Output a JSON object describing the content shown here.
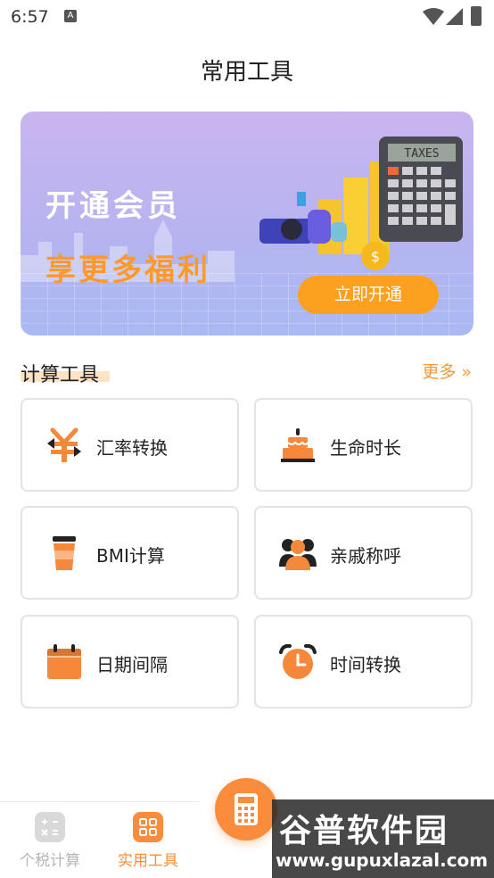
{
  "status_bar": {
    "time": "6:57",
    "notif_icon": "A"
  },
  "header": {
    "title": "常用工具"
  },
  "banner": {
    "line1": "开通会员",
    "line2": "享更多福利",
    "button_label": "立即开通",
    "calculator_label": "TAXES",
    "colors": {
      "button": "#fca020",
      "line2": "#ff9a2a"
    }
  },
  "section": {
    "title": "计算工具",
    "more_label": "更多 »"
  },
  "tools": [
    {
      "label": "汇率转换",
      "icon": "currency-exchange-icon"
    },
    {
      "label": "生命时长",
      "icon": "birthday-cake-icon"
    },
    {
      "label": "BMI计算",
      "icon": "cup-icon"
    },
    {
      "label": "亲戚称呼",
      "icon": "people-icon"
    },
    {
      "label": "日期间隔",
      "icon": "calendar-icon"
    },
    {
      "label": "时间转换",
      "icon": "alarm-clock-icon"
    }
  ],
  "tabbar": {
    "tabs": [
      {
        "label": "个税计算",
        "icon": "tax-calc-icon",
        "active": false
      },
      {
        "label": "实用工具",
        "icon": "tools-grid-icon",
        "active": true
      }
    ],
    "center_icon": "calculator-icon"
  },
  "watermark": {
    "line1": "谷普软件园",
    "line2": "www.gupuxlazal.com"
  },
  "accent": "#fa8c3c"
}
